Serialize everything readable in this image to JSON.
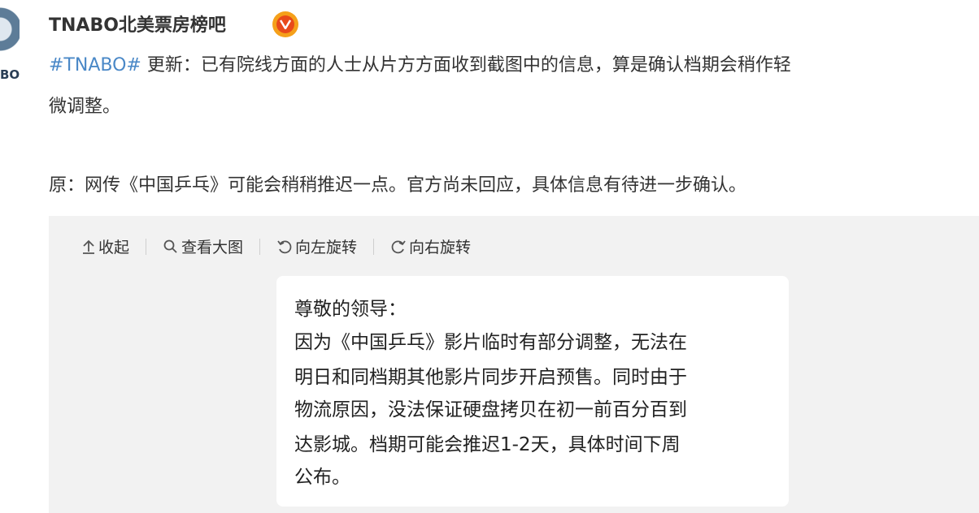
{
  "post": {
    "author": "TNABO北美票房榜吧",
    "avatar_text": "BO",
    "hashtag": "#TNABO#",
    "line1_rest": " 更新：已有院线方面的人士从片方方面收到截图中的信息，算是确认档期会稍作轻",
    "line2": "微调整。",
    "line3": "原：网传《中国乒乓》可能会稍稍推迟一点。官方尚未回应，具体信息有待进一步确认。"
  },
  "toolbar": {
    "collapse": "收起",
    "view_large": "查看大图",
    "rotate_left": "向左旋转",
    "rotate_right": "向右旋转"
  },
  "image_text": {
    "lines": [
      "尊敬的领导：",
      "因为《中国乒乓》影片临时有部分调整，无法在",
      "明日和同档期其他影片同步开启预售。同时由于",
      "物流原因，没法保证硬盘拷贝在初一前百分百到",
      "达影城。档期可能会推迟1-2天，具体时间下周",
      "公布。"
    ]
  },
  "colors": {
    "hashtag": "#4a88c7",
    "verified_outer": "#f5a01a",
    "verified_inner": "#e84a1a",
    "panel_bg": "#f2f2f2"
  },
  "icons": {
    "verified": "verified-v-icon",
    "collapse": "arrow-up-icon",
    "view_large": "magnifier-icon",
    "rotate_left": "rotate-left-icon",
    "rotate_right": "rotate-right-icon"
  }
}
